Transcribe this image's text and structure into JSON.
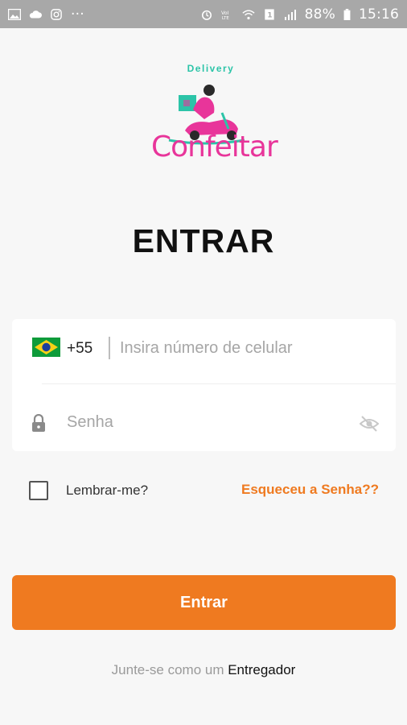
{
  "status_bar": {
    "battery": "88%",
    "time": "15:16",
    "notif_dots": "···",
    "left_icons": [
      "image-icon",
      "cloud-icon",
      "instagram-icon"
    ],
    "right_icons": [
      "alarm-icon",
      "volte-icon",
      "wifi-icon",
      "sim1-icon",
      "signal-icon",
      "battery-icon"
    ]
  },
  "logo": {
    "top_text": "Delivery",
    "word": "Confeitar",
    "colors": {
      "pink": "#e8359a",
      "teal": "#2cc4a8"
    }
  },
  "page_title": "ENTRAR",
  "login": {
    "country_code": "+55",
    "phone_placeholder": "Insira número de celular",
    "password_placeholder": "Senha"
  },
  "remember_label": "Lembrar-me?",
  "forgot_label": "Esqueceu a Senha??",
  "submit_label": "Entrar",
  "join": {
    "prefix": "Junte-se como um ",
    "link": "Entregador"
  },
  "colors": {
    "accent": "#ef7a20",
    "background": "#f7f7f7"
  }
}
